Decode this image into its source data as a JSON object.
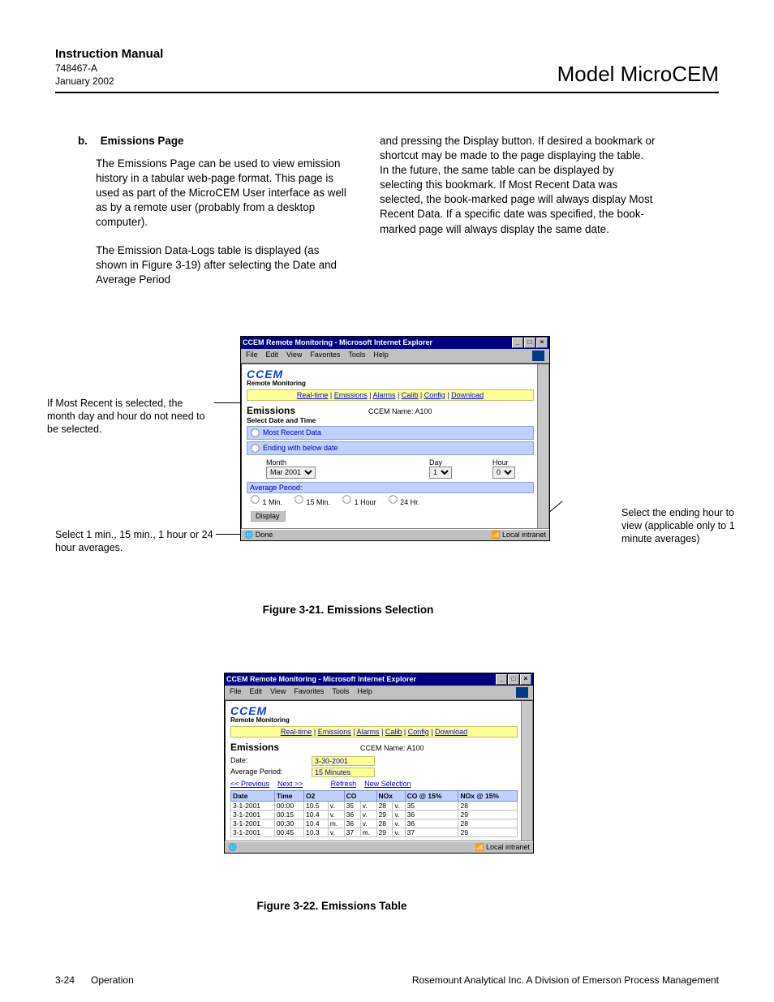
{
  "header": {
    "title": "Instruction Manual",
    "doc_id": "748467-A",
    "date": "January 2002",
    "model": "Model MicroCEM"
  },
  "section": {
    "letter": "b.",
    "title": "Emissions Page",
    "para1": "The Emissions Page can be used to view emission history in a tabular web-page format.  This page is used as part of the MicroCEM User interface as well as by a remote user (probably from a desktop computer).",
    "para2": "The Emission Data-Logs table is displayed (as shown in Figure 3-19) after selecting the Date and Average Period",
    "para3": "and pressing the Display button.  If desired a bookmark or shortcut may be made to the page displaying the table.  In the future, the same table can be displayed by selecting this bookmark.  If Most Recent Data was selected, the book-marked page will always display Most Recent Data.  If a specific date was specified, the book-marked page will always display the same date."
  },
  "annot": {
    "left_top": "If Most Recent is selected, the month day and hour do not need to be selected.",
    "left_bottom": "Select 1 min., 15 min., 1 hour or 24 hour averages.",
    "right": "Select the ending hour to view (applicable  only to 1 minute averages)"
  },
  "ie": {
    "title": "CCEM Remote Monitoring - Microsoft Internet Explorer",
    "menu": {
      "file": "File",
      "edit": "Edit",
      "view": "View",
      "fav": "Favorites",
      "tools": "Tools",
      "help": "Help"
    },
    "brand": "CCEM",
    "brand_sub": "Remote Monitoring",
    "nav": {
      "rt": "Real-time",
      "em": "Emissions",
      "al": "Alarms",
      "ca": "Calib",
      "co": "Config",
      "dl": "Download"
    },
    "emissions_h": "Emissions",
    "ccem_name_label": "CCEM Name: A100",
    "sel_dt": "Select Date and Time",
    "most_recent": "Most Recent Data",
    "ending": "Ending with below date",
    "month_label": "Month",
    "month_val": "Mar 2001",
    "day_label": "Day",
    "day_val": "1",
    "hour_label": "Hour",
    "hour_val": "0",
    "avg_period": "Average Period:",
    "avg_opts": {
      "m1": "1 Min.",
      "m15": "15 Min.",
      "h1": "1 Hour",
      "h24": "24 Hr."
    },
    "display_btn": "Display",
    "status_done": "Done",
    "status_zone": "Local intranet"
  },
  "fig1_caption": "Figure 3-21.  Emissions Selection",
  "ie2": {
    "date_label": "Date:",
    "date_val": "3-30-2001",
    "avg_label": "Average Period:",
    "avg_val": "15 Minutes",
    "links": {
      "prev": "<< Previous",
      "next": "Next >>",
      "refresh": "Refresh",
      "newsel": "New Selection"
    },
    "cols": {
      "date": "Date",
      "time": "Time",
      "o2": "O2",
      "co": "CO",
      "nox": "NOx",
      "co15": "CO @ 15%",
      "nox15": "NOx @ 15%"
    },
    "rows": [
      {
        "date": "3-1-2001",
        "time": "00:00",
        "o2": "10.5",
        "o2f": "v.",
        "co": "35",
        "cof": "v.",
        "nox": "28",
        "noxf": "v.",
        "co15": "35",
        "nox15": "28"
      },
      {
        "date": "3-1-2001",
        "time": "00:15",
        "o2": "10.4",
        "o2f": "v.",
        "co": "36",
        "cof": "v.",
        "nox": "29",
        "noxf": "v.",
        "co15": "36",
        "nox15": "29"
      },
      {
        "date": "3-1-2001",
        "time": "00:30",
        "o2": "10.4",
        "o2f": "m.",
        "co": "36",
        "cof": "v.",
        "nox": "28",
        "noxf": "v.",
        "co15": "36",
        "nox15": "28"
      },
      {
        "date": "3-1-2001",
        "time": "00:45",
        "o2": "10.3",
        "o2f": "v.",
        "co": "37",
        "cof": "m.",
        "nox": "29",
        "noxf": "v.",
        "co15": "37",
        "nox15": "29"
      }
    ]
  },
  "fig2_caption": "Figure 3-22.  Emissions Table",
  "footer": {
    "page": "3-24",
    "section": "Operation",
    "company": "Rosemount Analytical Inc.    A Division of Emerson Process Management"
  }
}
